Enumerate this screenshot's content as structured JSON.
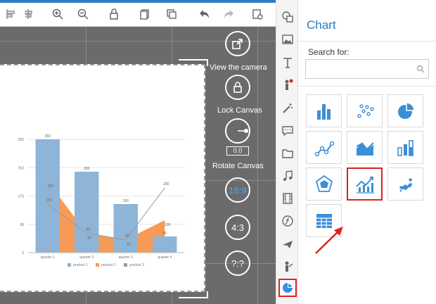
{
  "colors": {
    "accent": "#2a7abf",
    "icon_blue": "#3b8fd8",
    "highlight": "#e02020",
    "bar_blue": "#8eb4d8",
    "area_orange": "#f79a55",
    "line_gray": "#999999"
  },
  "toolbar": {
    "buttons": [
      "align-icon",
      "distribute-icon",
      "zoom-in-icon",
      "zoom-out-icon",
      "lock-icon",
      "copy-icon",
      "layers-icon",
      "undo-icon",
      "redo-icon",
      "preview-icon"
    ]
  },
  "stage": {
    "controls": {
      "view_camera": "View the camera",
      "lock_canvas": "Lock Canvas",
      "rotate_value": "0.0",
      "rotate_canvas": "Rotate Canvas",
      "ratio_169": "16:9",
      "ratio_43": "4:3",
      "ratio_custom": "?:?"
    }
  },
  "chart_data": {
    "type": "bar",
    "categories": [
      "quarter 1",
      "quarter 2",
      "quarter 3",
      "quarter 4"
    ],
    "series": [
      {
        "name": "product 1",
        "type": "bar",
        "values": [
          350,
          250,
          150,
          50
        ]
      },
      {
        "name": "product 2",
        "type": "area",
        "values": [
          220,
          60,
          40,
          100
        ]
      },
      {
        "name": "product 3",
        "type": "line",
        "values": [
          150,
          60,
          40,
          200
        ]
      }
    ],
    "yticks": [
      "350",
      "263",
      "175",
      "88",
      "0"
    ],
    "ylim": [
      0,
      350
    ],
    "legend": "bottom",
    "grid": true
  },
  "panel": {
    "title": "Chart",
    "search_label": "Search for:",
    "search_value": "",
    "tiles": [
      "bar-chart-icon",
      "scatter-chart-icon",
      "pie-chart-icon",
      "line-chart-icon",
      "area-chart-icon",
      "stacked-bar-icon",
      "radar-chart-icon",
      "combo-chart-icon",
      "map-chart-icon",
      "table-chart-icon"
    ]
  }
}
